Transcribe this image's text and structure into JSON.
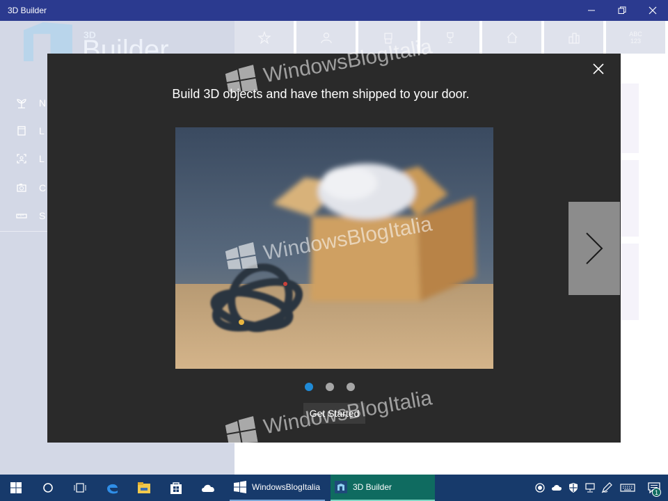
{
  "window": {
    "title": "3D Builder",
    "minimize_glyph": "—",
    "maximize_glyph": "❐",
    "close_glyph": "✕"
  },
  "sidebar": {
    "logo_small": "3D",
    "logo_word": "Builder",
    "items": [
      {
        "icon": "plant-icon",
        "label": "N"
      },
      {
        "icon": "frame-icon",
        "label": "L"
      },
      {
        "icon": "scan-icon",
        "label": "L"
      },
      {
        "icon": "camera-icon",
        "label": "C"
      },
      {
        "icon": "ruler-icon",
        "label": "S"
      }
    ]
  },
  "content": {
    "tabs": [
      {
        "icon": "star-icon",
        "label": ""
      },
      {
        "icon": "person-icon",
        "label": ""
      },
      {
        "icon": "robot-icon",
        "label": ""
      },
      {
        "icon": "trophy-icon",
        "label": ""
      },
      {
        "icon": "home-icon",
        "label": ""
      },
      {
        "icon": "city-icon",
        "label": ""
      },
      {
        "icon": "abc-icon",
        "label": "ABC 123"
      }
    ]
  },
  "dialog": {
    "headline": "Build 3D objects and have them shipped to your door.",
    "get_started_label": "Get Started",
    "page_count": 3,
    "active_page": 1
  },
  "watermark": {
    "text": "WindowsBlogItalia"
  },
  "taskbar": {
    "apps": [
      {
        "label": "WindowsBlogItalia",
        "icon": "windowsblogitalia-icon"
      },
      {
        "label": "3D Builder",
        "icon": "3d-builder-icon"
      }
    ],
    "notification_count": "1"
  },
  "colors": {
    "titlebar": "#2b3a8f",
    "taskbar": "#173a6b",
    "dialog_bg": "#2a2a2a",
    "active_dot": "#1f8ad6",
    "active_app": "#0f6b60"
  }
}
